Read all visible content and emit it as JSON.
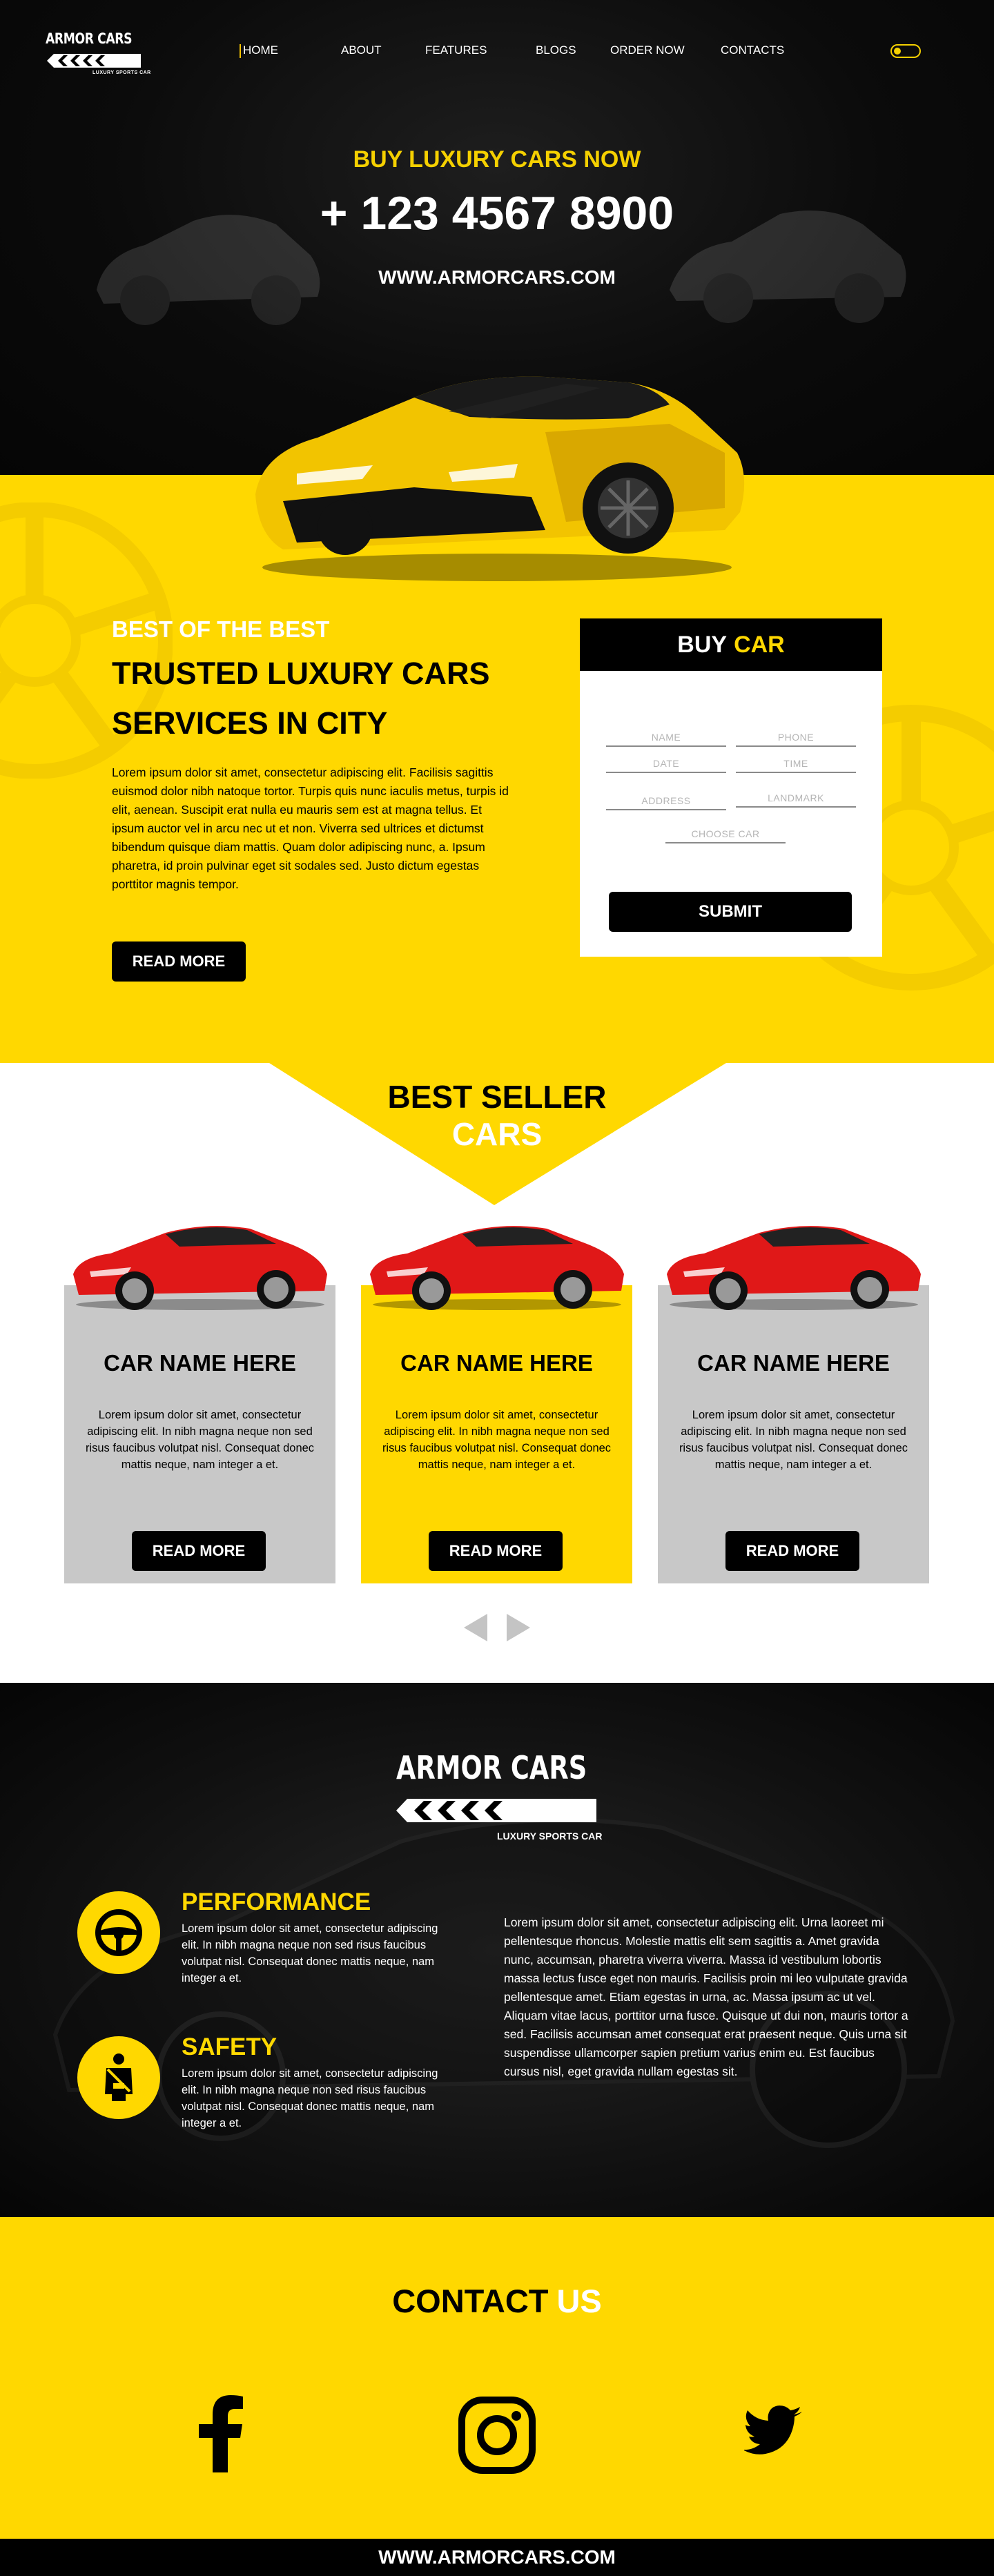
{
  "brand": {
    "name": "ARMOR CARS",
    "tagline": "LUXURY SPORTS CAR"
  },
  "nav": {
    "items": [
      "HOME",
      "ABOUT",
      "FEATURES",
      "BLOGS",
      "ORDER NOW",
      "CONTACTS"
    ],
    "active": "HOME"
  },
  "hero": {
    "kicker": "BUY LUXURY CARS NOW",
    "phone": "+ 123 4567 8900",
    "url": "WWW.ARMORCARS.COM"
  },
  "about": {
    "kicker": "BEST OF THE BEST",
    "title": "TRUSTED LUXURY CARS SERVICES IN CITY",
    "text": "Lorem ipsum dolor sit amet, consectetur adipiscing elit. Facilisis sagittis euismod dolor nibh natoque tortor. Turpis quis nunc iaculis metus, turpis id elit, aenean. Suscipit erat nulla eu mauris sem est at magna tellus. Et ipsum auctor vel in arcu nec ut et non. Viverra sed ultrices et dictumst bibendum quisque diam mattis. Quam dolor adipiscing nunc, a. Ipsum pharetra, id proin pulvinar eget sit sodales sed. Justo dictum egestas porttitor magnis tempor.",
    "button": "READ MORE"
  },
  "buy_form": {
    "title_white": "BUY",
    "title_yellow": "CAR",
    "fields": {
      "name": "NAME",
      "phone": "PHONE",
      "date": "DATE",
      "time": "TIME",
      "address": "ADDRESS",
      "landmark": "LANDMARK",
      "choose_car": "CHOOSE CAR"
    },
    "submit": "SUBMIT"
  },
  "best_seller": {
    "title_line1": "BEST SELLER",
    "title_line2": "CARS",
    "cards": [
      {
        "name": "CAR NAME HERE",
        "text": "Lorem ipsum dolor sit amet, consectetur adipiscing elit. In nibh magna neque non sed risus faucibus volutpat nisl. Consequat donec mattis neque, nam integer a et.",
        "button": "READ MORE",
        "color": "#c8c8c8"
      },
      {
        "name": "CAR NAME HERE",
        "text": "Lorem ipsum dolor sit amet, consectetur adipiscing elit. In nibh magna neque non sed risus faucibus volutpat nisl. Consequat donec mattis neque, nam integer a et.",
        "button": "READ MORE",
        "color": "#ffd800"
      },
      {
        "name": "CAR NAME HERE",
        "text": "Lorem ipsum dolor sit amet, consectetur adipiscing elit. In nibh magna neque non sed risus faucibus volutpat nisl. Consequat donec mattis neque, nam integer a et.",
        "button": "READ MORE",
        "color": "#c8c8c8"
      }
    ]
  },
  "features": {
    "brand": "ARMOR CARS",
    "tagline": "LUXURY SPORTS CAR",
    "items": [
      {
        "title": "PERFORMANCE",
        "icon": "steering-wheel-icon",
        "text": "Lorem ipsum dolor sit amet, consectetur adipiscing elit. In nibh magna neque non sed risus faucibus volutpat nisl. Consequat donec mattis neque, nam integer a et."
      },
      {
        "title": "SAFETY",
        "icon": "seatbelt-icon",
        "text": "Lorem ipsum dolor sit amet, consectetur adipiscing elit. In nibh magna neque non sed risus faucibus volutpat nisl. Consequat donec mattis neque, nam integer a et."
      }
    ],
    "paragraph": "Lorem ipsum dolor sit amet, consectetur adipiscing elit. Urna laoreet mi pellentesque rhoncus. Molestie mattis elit sem sagittis a. Amet gravida nunc, accumsan, pharetra viverra viverra. Massa id vestibulum lobortis massa lectus fusce eget non mauris. Facilisis proin mi leo vulputate gravida pellentesque amet. Etiam egestas in urna, ac. Massa ipsum ac ut vel. Aliquam vitae lacus, porttitor urna fusce. Quisque ut dui non, mauris tortor a sed. Facilisis accumsan amet consequat erat praesent neque. Quis urna sit suspendisse ullamcorper sapien pretium varius enim eu. Est faucibus cursus nisl, eget gravida nullam egestas sit."
  },
  "contact": {
    "title_black": "CONTACT",
    "title_white": "US",
    "socials": [
      "facebook-icon",
      "instagram-icon",
      "twitter-icon"
    ]
  },
  "footer": {
    "url": "WWW.ARMORCARS.COM"
  },
  "colors": {
    "accent": "#ffd800",
    "dark": "#000000",
    "card_gray": "#c8c8c8",
    "car_red": "#e01818"
  }
}
